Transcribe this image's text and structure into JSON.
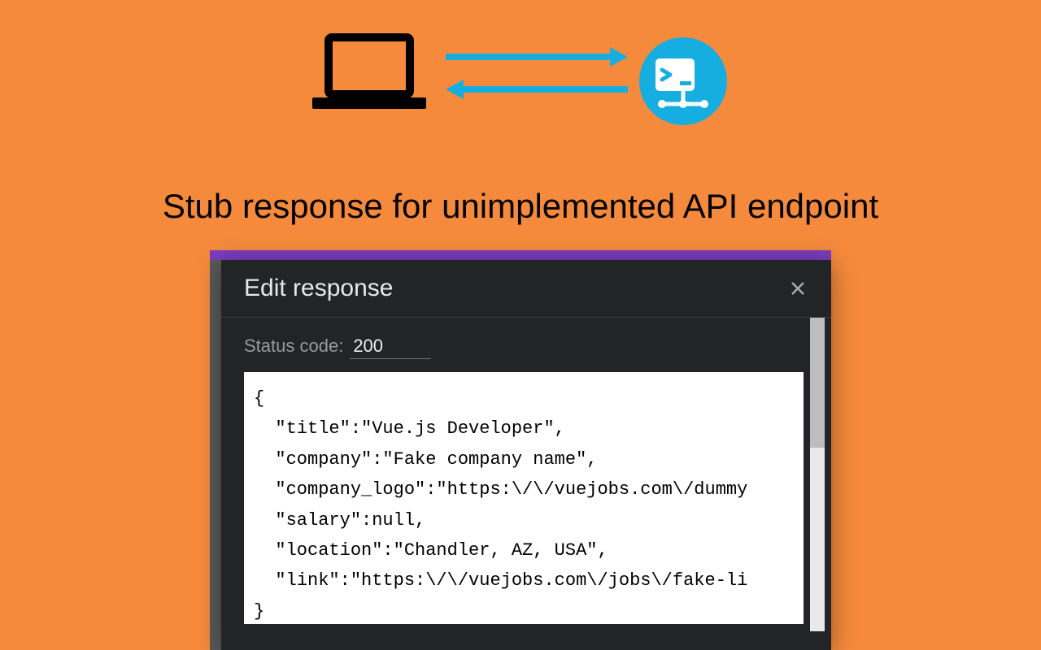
{
  "caption": "Stub response for unimplemented API endpoint",
  "modal": {
    "title": "Edit response",
    "status_label": "Status code:",
    "status_value": "200",
    "response_body": "{\n  \"title\":\"Vue.js Developer\",\n  \"company\":\"Fake company name\",\n  \"company_logo\":\"https:\\/\\/vuejobs.com\\/dummy\n  \"salary\":null,\n  \"location\":\"Chandler, AZ, USA\",\n  \"link\":\"https:\\/\\/vuejobs.com\\/jobs\\/fake-li\n}"
  },
  "colors": {
    "accent_blue": "#16aee0",
    "background": "#f58a3c",
    "purple": "#7c3dbf"
  }
}
